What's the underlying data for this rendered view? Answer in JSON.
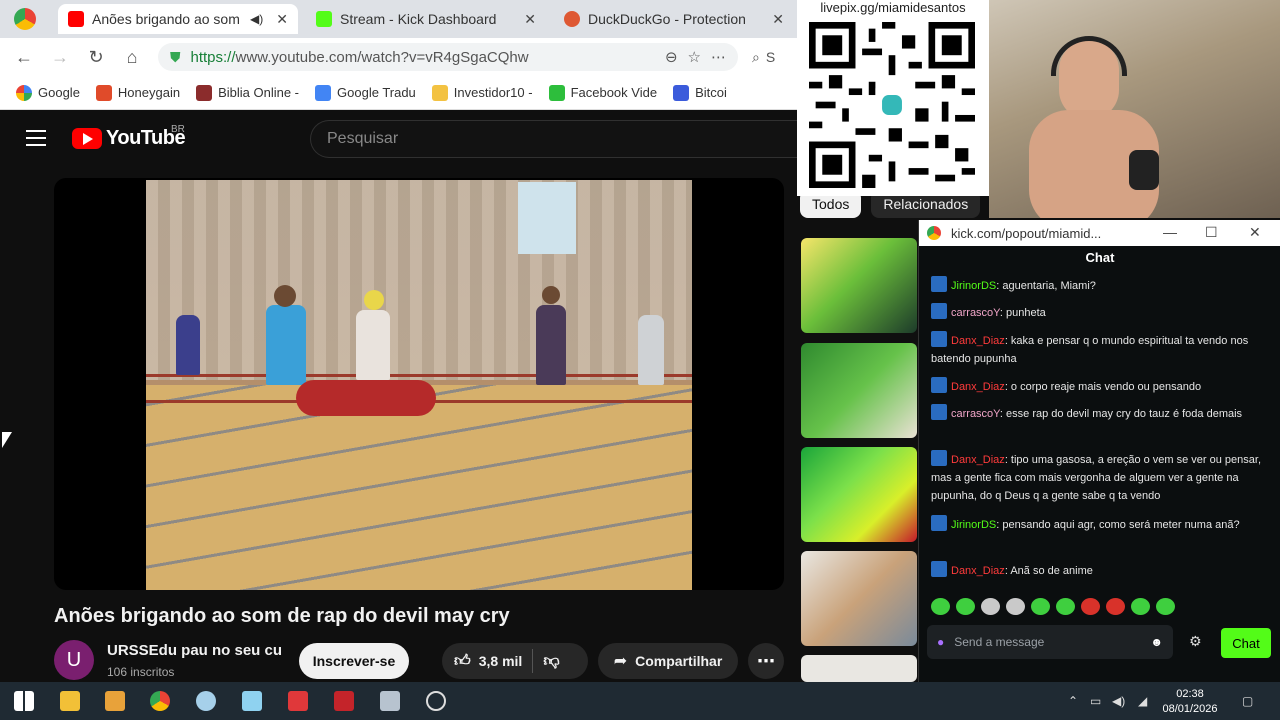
{
  "browser": {
    "tabs": [
      {
        "label": "Anões brigando ao som",
        "active": true
      },
      {
        "label": "Stream - Kick Dashboard",
        "active": false
      },
      {
        "label": "DuckDuckGo - Protection",
        "active": false
      }
    ],
    "close_glyph": "✕",
    "url_https": "https://",
    "url_rest": "www.youtube.com/watch?v=vR4gSgaCQhw",
    "search_partial": "S",
    "bookmarks": [
      "Google",
      "Honeygain",
      "Biblia Online -",
      "Google Tradu",
      "Investidor10 -",
      "Facebook Vide",
      "Bitcoi"
    ]
  },
  "youtube": {
    "logo_text": "YouTube",
    "region": "BR",
    "search_placeholder": "Pesquisar",
    "video_title": "Anões brigando ao som de rap do devil may cry",
    "channel_initial": "U",
    "channel_name": "URSSEdu pau no seu cu",
    "subscribers": "106 inscritos",
    "subscribe_label": "Inscrever-se",
    "likes": "3,8 mil",
    "share_label": "Compartilhar",
    "chips": [
      "Todos",
      "Relacionados"
    ]
  },
  "overlay": {
    "pix_label": "livepix.gg/miamidesantos"
  },
  "kick": {
    "window_title": "kick.com/popout/miamid...",
    "chat_title": "Chat",
    "messages": [
      {
        "user": "JirinorDS",
        "text": ": aguentaria, Miami?",
        "color": "g"
      },
      {
        "user": "carrascoY",
        "text": ": punheta",
        "color": "p"
      },
      {
        "user": "Danx_Diaz",
        "text": ": kaka e pensar q o mundo espiritual ta vendo nos batendo pupunha",
        "color": "r"
      },
      {
        "user": "Danx_Diaz",
        "text": ": o corpo reaje mais vendo ou pensando",
        "color": "r"
      },
      {
        "user": "carrascoY",
        "text": ": esse rap do devil may cry do tauz é foda demais",
        "color": "p"
      },
      {
        "user": "Danx_Diaz",
        "text": ": tipo uma gasosa, a ereção o vem se ver ou pensar, mas a gente fica com mais vergonha de alguem ver a gente na pupunha, do q Deus q a gente sabe q ta vendo",
        "color": "r"
      },
      {
        "user": "JirinorDS",
        "text": ": pensando aqui agr, como será meter numa anã?",
        "color": "g"
      },
      {
        "user": "Danx_Diaz",
        "text": ": Anã so de anime",
        "color": "r"
      }
    ],
    "input_placeholder": "Send a message",
    "chat_button": "Chat"
  },
  "taskbar": {
    "time": "02:38",
    "date": "08/01/2026"
  }
}
